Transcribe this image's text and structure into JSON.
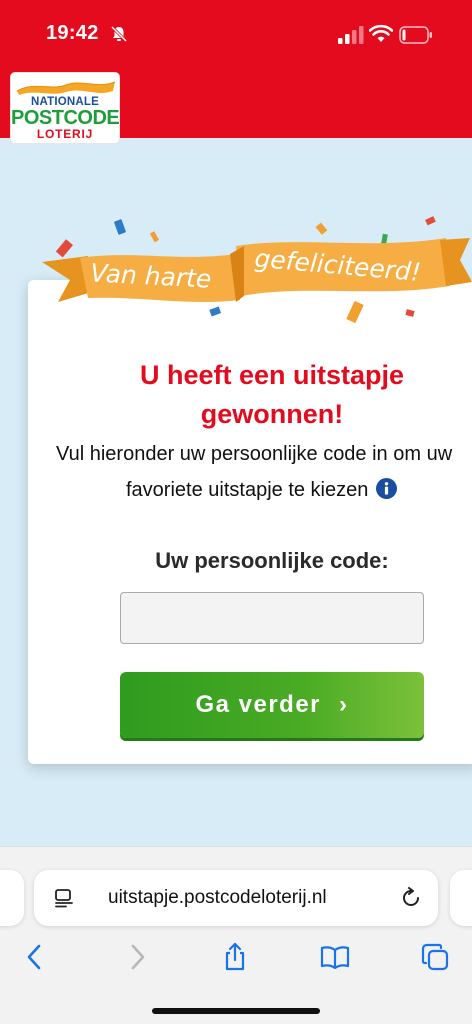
{
  "status_bar": {
    "time": "19:42"
  },
  "logo": {
    "line1": "NATIONALE",
    "line2": "POSTCODE",
    "line3": "LOTERIJ"
  },
  "banner": {
    "text_left": "Van harte",
    "text_right": "gefeliciteerd!"
  },
  "card": {
    "headline_line1": "U heeft een uitstapje",
    "headline_line2": "gewonnen!",
    "instruction_line1": "Vul hieronder uw persoonlijke code in om uw",
    "instruction_line2": "favoriete uitstapje te kiezen",
    "code_label": "Uw persoonlijke code:",
    "code_value": "",
    "button_label": "Ga verder",
    "button_chevron": "›"
  },
  "browser": {
    "url": "uitstapje.postcodeloterij.nl"
  },
  "icons": {
    "info": "info-icon",
    "back": "back-icon",
    "forward": "forward-icon",
    "share": "share-icon",
    "bookmarks": "bookmarks-icon",
    "tabs": "tabs-icon",
    "reload": "reload-icon",
    "page": "page-menu-icon"
  },
  "colors": {
    "brand_red": "#e30b1d",
    "brand_green": "#1e9e3a",
    "brand_blue": "#1a4ea1",
    "button_green": "#4aab24",
    "ios_blue": "#1a73e8"
  }
}
